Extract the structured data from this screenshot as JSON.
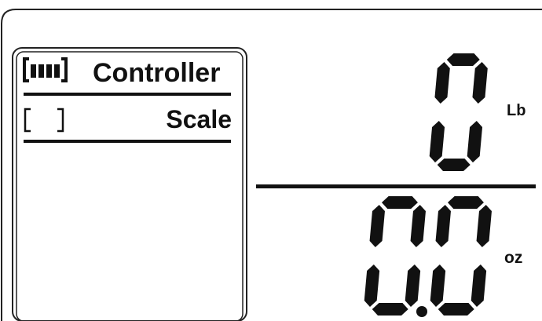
{
  "status_panel": {
    "controller": {
      "label": "Controller",
      "battery_icon": "battery-full-icon",
      "connected": true
    },
    "scale": {
      "label": "Scale",
      "battery_icon": "battery-empty-icon",
      "connected": false
    }
  },
  "readout": {
    "pounds": {
      "value": "0",
      "unit": "Lb"
    },
    "ounces": {
      "value": "0.0",
      "unit": "oz"
    }
  },
  "colors": {
    "segment": "#111111",
    "background": "#ffffff"
  }
}
